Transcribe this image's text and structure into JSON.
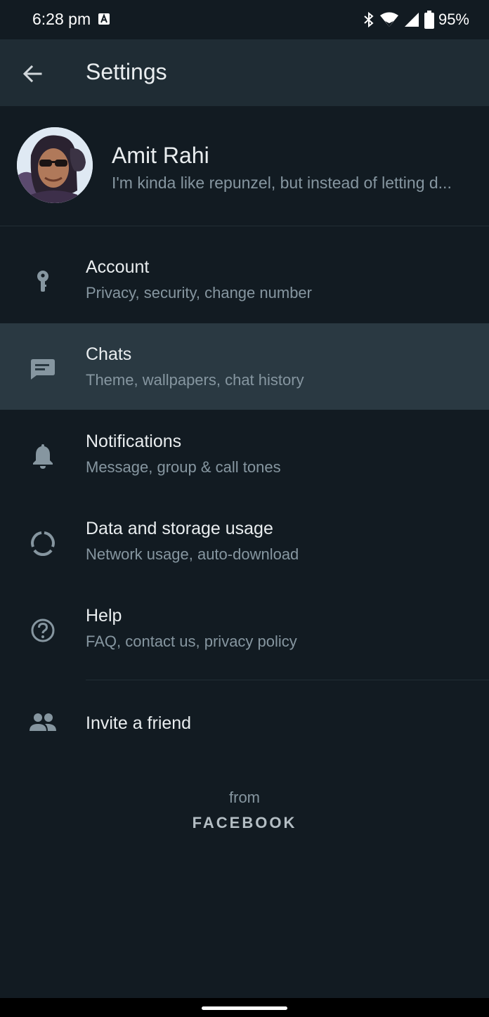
{
  "status_bar": {
    "time": "6:28 pm",
    "battery": "95%",
    "icons": [
      "app-a-icon",
      "bluetooth-icon",
      "wifi-icon",
      "signal-icon",
      "battery-icon"
    ]
  },
  "app_bar": {
    "title": "Settings",
    "back_icon": "arrow-left-icon"
  },
  "profile": {
    "name": "Amit Rahi",
    "status": "I'm kinda like repunzel, but instead of letting d..."
  },
  "menu": [
    {
      "title": "Account",
      "subtitle": "Privacy, security, change number",
      "icon": "key-icon"
    },
    {
      "title": "Chats",
      "subtitle": "Theme, wallpapers, chat history",
      "icon": "chat-icon"
    },
    {
      "title": "Notifications",
      "subtitle": "Message, group & call tones",
      "icon": "bell-icon"
    },
    {
      "title": "Data and storage usage",
      "subtitle": "Network usage, auto-download",
      "icon": "data-usage-icon"
    },
    {
      "title": "Help",
      "subtitle": "FAQ, contact us, privacy policy",
      "icon": "help-icon"
    }
  ],
  "invite": {
    "label": "Invite a friend",
    "icon": "people-icon"
  },
  "footer": {
    "from": "from",
    "brand": "FACEBOOK"
  },
  "colors": {
    "background": "#121b22",
    "app_bar": "#1f2c34",
    "active_row": "#2a3942",
    "primary_text": "#e9edef",
    "secondary_text": "#8696a0"
  }
}
